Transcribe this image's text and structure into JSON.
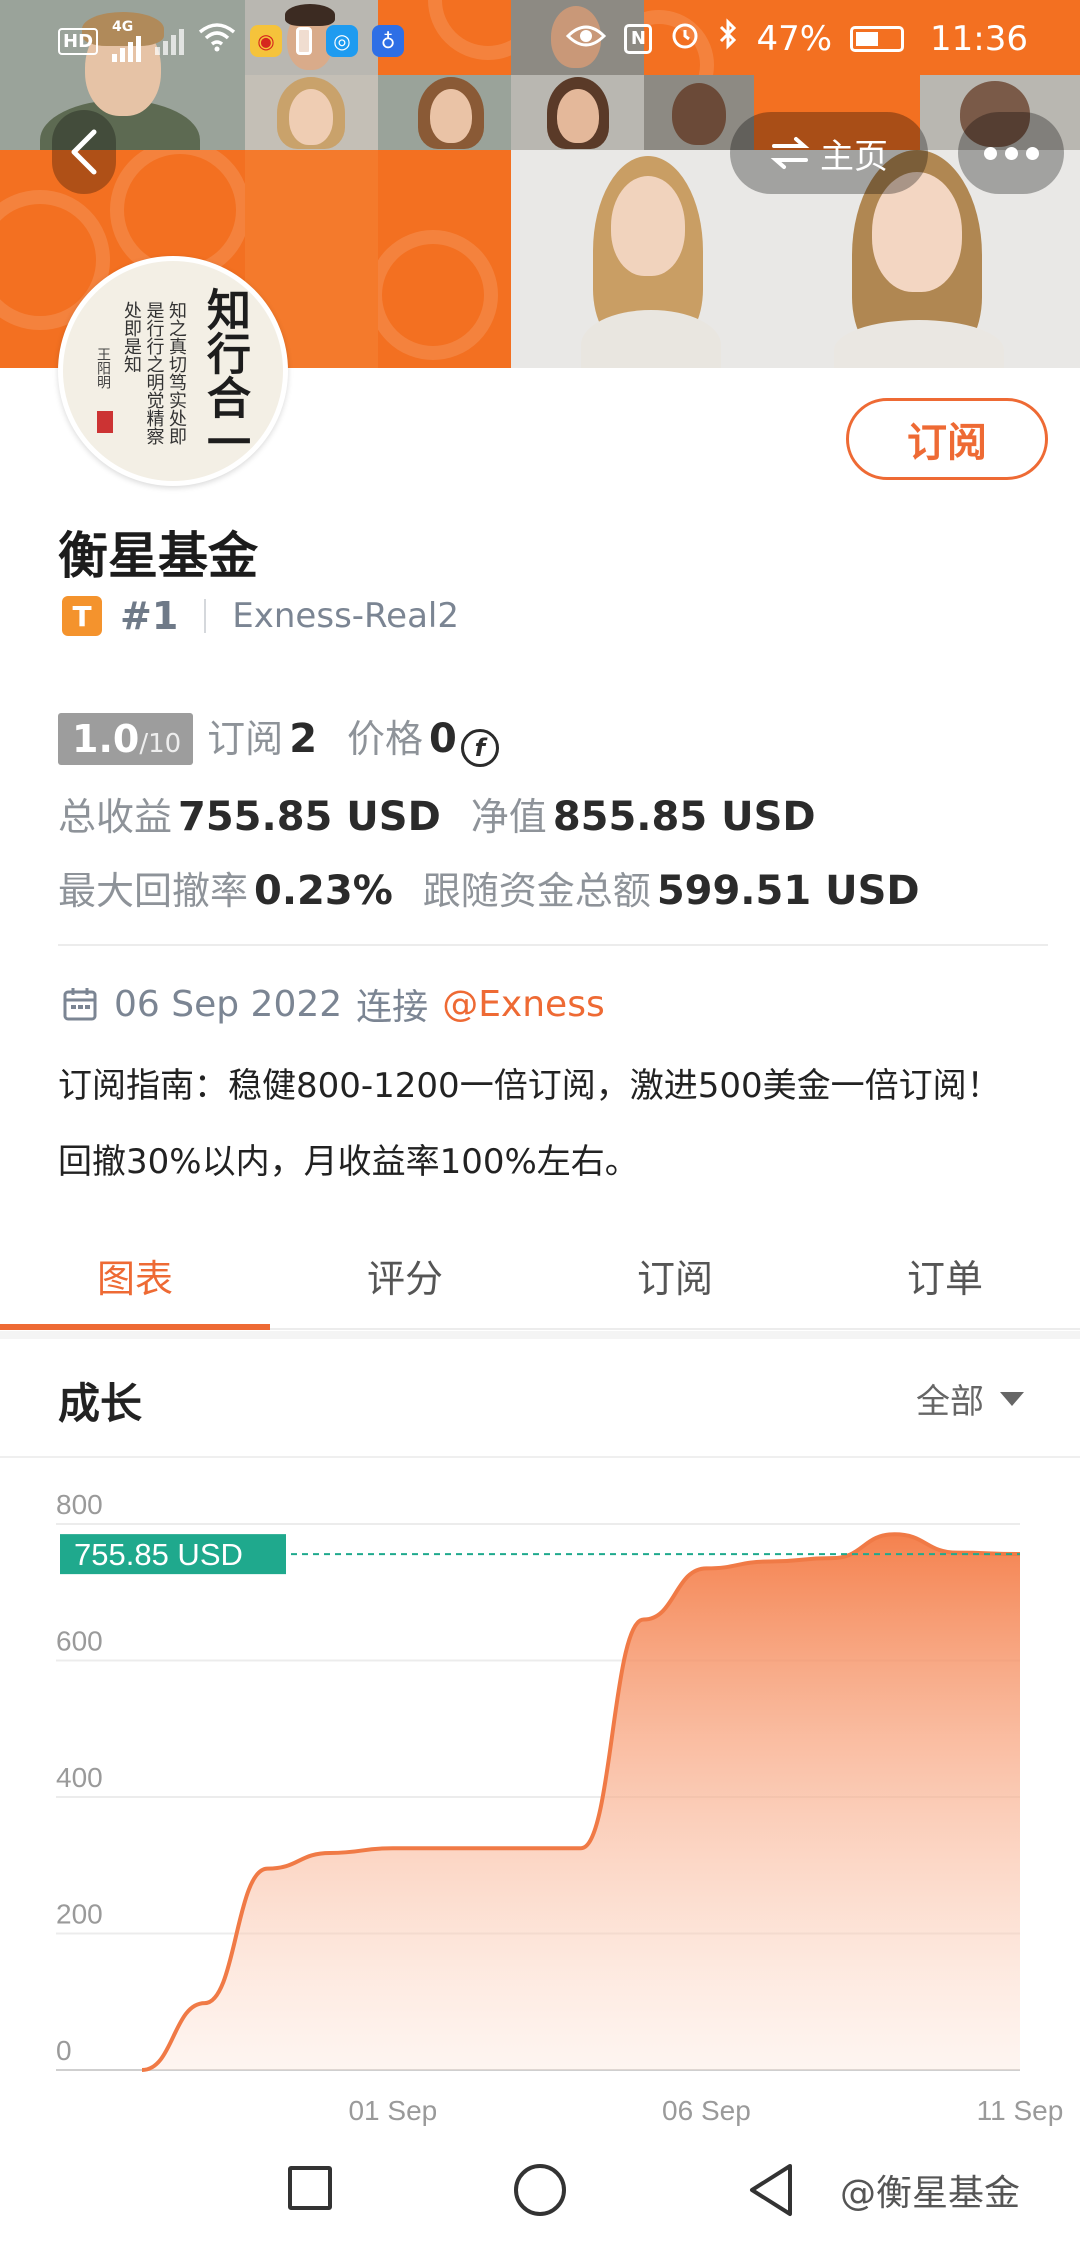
{
  "status_bar": {
    "left_badges": [
      "HD",
      "4G"
    ],
    "battery": "47%",
    "time": "11:36"
  },
  "header": {
    "home_label": "主页",
    "icons": {
      "back": "chevron-left-icon",
      "home": "swap-icon",
      "more": "more-dots-icon"
    }
  },
  "profile": {
    "avatar_big_text": "知行合一",
    "avatar_small_text": "知之真切笃实处即是行行之明觉精察处即是知",
    "avatar_signature": "王阳明",
    "subscribe_label": "订阅",
    "name": "衡星基金",
    "badge_letter": "T",
    "rank": "#1",
    "account": "Exness-Real2"
  },
  "stats": {
    "score": "1.0",
    "score_max": "/10",
    "subscribe_label": "订阅",
    "subscribe_count": "2",
    "price_label": "价格",
    "price_value": "0",
    "total_profit_label": "总收益",
    "total_profit_value": "755.85 USD",
    "net_value_label": "净值",
    "net_value_value": "855.85 USD",
    "max_drawdown_label": "最大回撤率",
    "max_drawdown_value": "0.23%",
    "follow_total_label": "跟随资金总额",
    "follow_total_value": "599.51 USD"
  },
  "connection": {
    "date": "06 Sep 2022",
    "connect_label": "连接",
    "broker": "@Exness"
  },
  "guide": {
    "line1": "订阅指南：稳健800-1200一倍订阅，激进500美金一倍订阅！",
    "line2": "回撤30%以内，月收益率100%左右。"
  },
  "tabs": [
    {
      "label": "图表",
      "active": true
    },
    {
      "label": "评分",
      "active": false
    },
    {
      "label": "订阅",
      "active": false
    },
    {
      "label": "订单",
      "active": false
    }
  ],
  "section": {
    "title": "成长",
    "filter_label": "全部"
  },
  "chart_data": {
    "type": "area",
    "title": "",
    "xlabel": "",
    "ylabel": "",
    "ylim": [
      0,
      800
    ],
    "y_ticks": [
      "0",
      "200",
      "400",
      "600",
      "800"
    ],
    "x_ticks": [
      "01 Sep",
      "06 Sep",
      "11 Sep"
    ],
    "current_value_label": "755.85 USD",
    "current_value": 755.85,
    "line_color": "#f07a46",
    "fill_color": "#f6a07a",
    "reference_color": "#1fa98d",
    "x": [
      "28 Aug",
      "29 Aug",
      "30 Aug",
      "31 Aug",
      "01 Sep",
      "02 Sep",
      "03 Sep",
      "04 Sep",
      "05 Sep",
      "06 Sep",
      "07 Sep",
      "08 Sep",
      "09 Sep",
      "10 Sep",
      "11 Sep"
    ],
    "values": [
      0,
      98,
      295,
      318,
      325,
      325,
      325,
      325,
      660,
      735,
      745,
      750,
      785,
      758,
      756
    ]
  },
  "nav_bar": {
    "watermark": "@衡星基金"
  }
}
